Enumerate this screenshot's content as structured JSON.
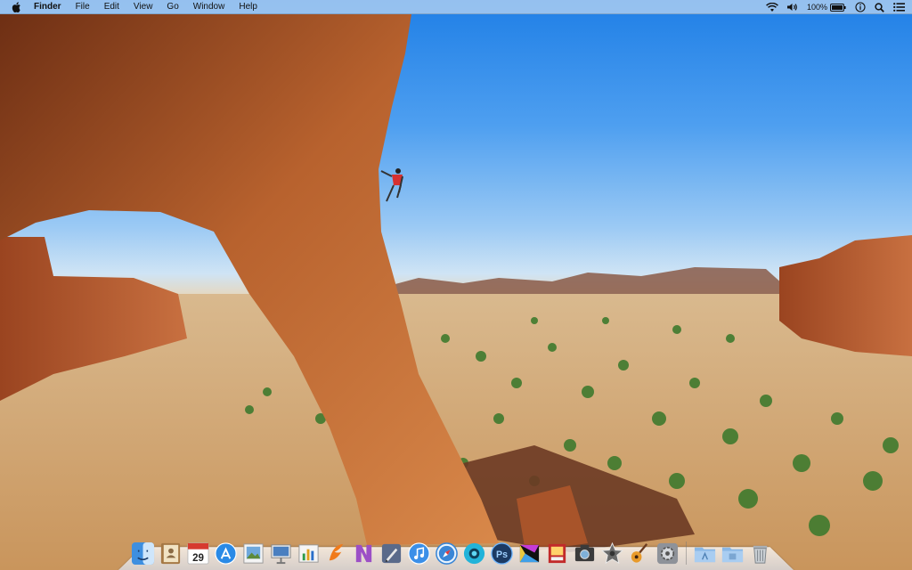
{
  "menubar": {
    "app_name": "Finder",
    "menus": [
      "File",
      "Edit",
      "View",
      "Go",
      "Window",
      "Help"
    ],
    "battery_percent": "100%"
  },
  "dock": {
    "calendar_day": "29",
    "items": [
      {
        "icon": "finder-icon"
      },
      {
        "icon": "contacts-icon"
      },
      {
        "icon": "calendar-icon"
      },
      {
        "icon": "app-store-icon"
      },
      {
        "icon": "preview-icon"
      },
      {
        "icon": "keynote-icon"
      },
      {
        "icon": "numbers-icon"
      },
      {
        "icon": "pages-icon"
      },
      {
        "icon": "onenote-icon"
      },
      {
        "icon": "pen-tool-icon"
      },
      {
        "icon": "itunes-icon"
      },
      {
        "icon": "safari-icon"
      },
      {
        "icon": "camera-app-icon"
      },
      {
        "icon": "photoshop-icon"
      },
      {
        "icon": "final-cut-icon"
      },
      {
        "icon": "photo-booth-icon"
      },
      {
        "icon": "image-capture-icon"
      },
      {
        "icon": "imovie-icon"
      },
      {
        "icon": "garageband-icon"
      },
      {
        "icon": "system-preferences-icon"
      },
      {
        "icon": "applications-folder-icon"
      },
      {
        "icon": "documents-folder-icon"
      },
      {
        "icon": "trash-icon"
      }
    ]
  },
  "colors": {
    "sky_top": "#1f7fe6",
    "rock": "#b85a2a",
    "ground": "#d4ac78",
    "tree": "#3f7a2e"
  }
}
